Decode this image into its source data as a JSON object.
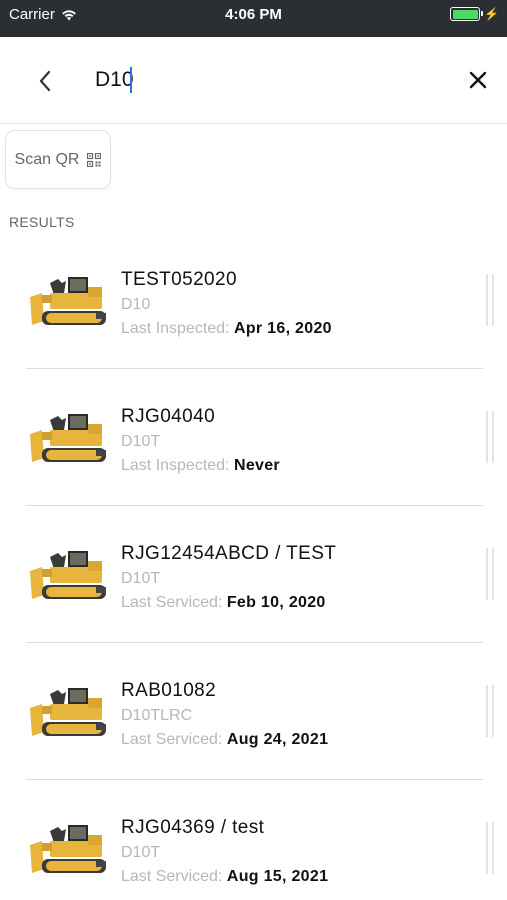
{
  "status_bar": {
    "carrier": "Carrier",
    "time": "4:06 PM",
    "battery_color": "#4cd964"
  },
  "search": {
    "value": "D10",
    "back_icon": "chevron-left-icon",
    "clear_icon": "close-icon"
  },
  "scan_qr": {
    "label": "Scan QR",
    "icon": "qr-code-icon"
  },
  "results_label": "RESULTS",
  "results": [
    {
      "name": "TEST052020",
      "model": "D10",
      "status_label": "Last Inspected:",
      "status_value": "Apr 16, 2020"
    },
    {
      "name": "RJG04040",
      "model": "D10T",
      "status_label": "Last Inspected:",
      "status_value": "Never"
    },
    {
      "name": "RJG12454ABCD / TEST",
      "model": "D10T",
      "status_label": "Last Serviced:",
      "status_value": "Feb 10, 2020"
    },
    {
      "name": "RAB01082",
      "model": "D10TLRC",
      "status_label": "Last Serviced:",
      "status_value": "Aug 24, 2021"
    },
    {
      "name": "RJG04369 / test",
      "model": "D10T",
      "status_label": "Last Serviced:",
      "status_value": "Aug 15, 2021"
    }
  ],
  "colors": {
    "accent": "#2f6fe0",
    "machine_yellow": "#e7b43c",
    "status_bar_bg": "#2b2e33"
  }
}
